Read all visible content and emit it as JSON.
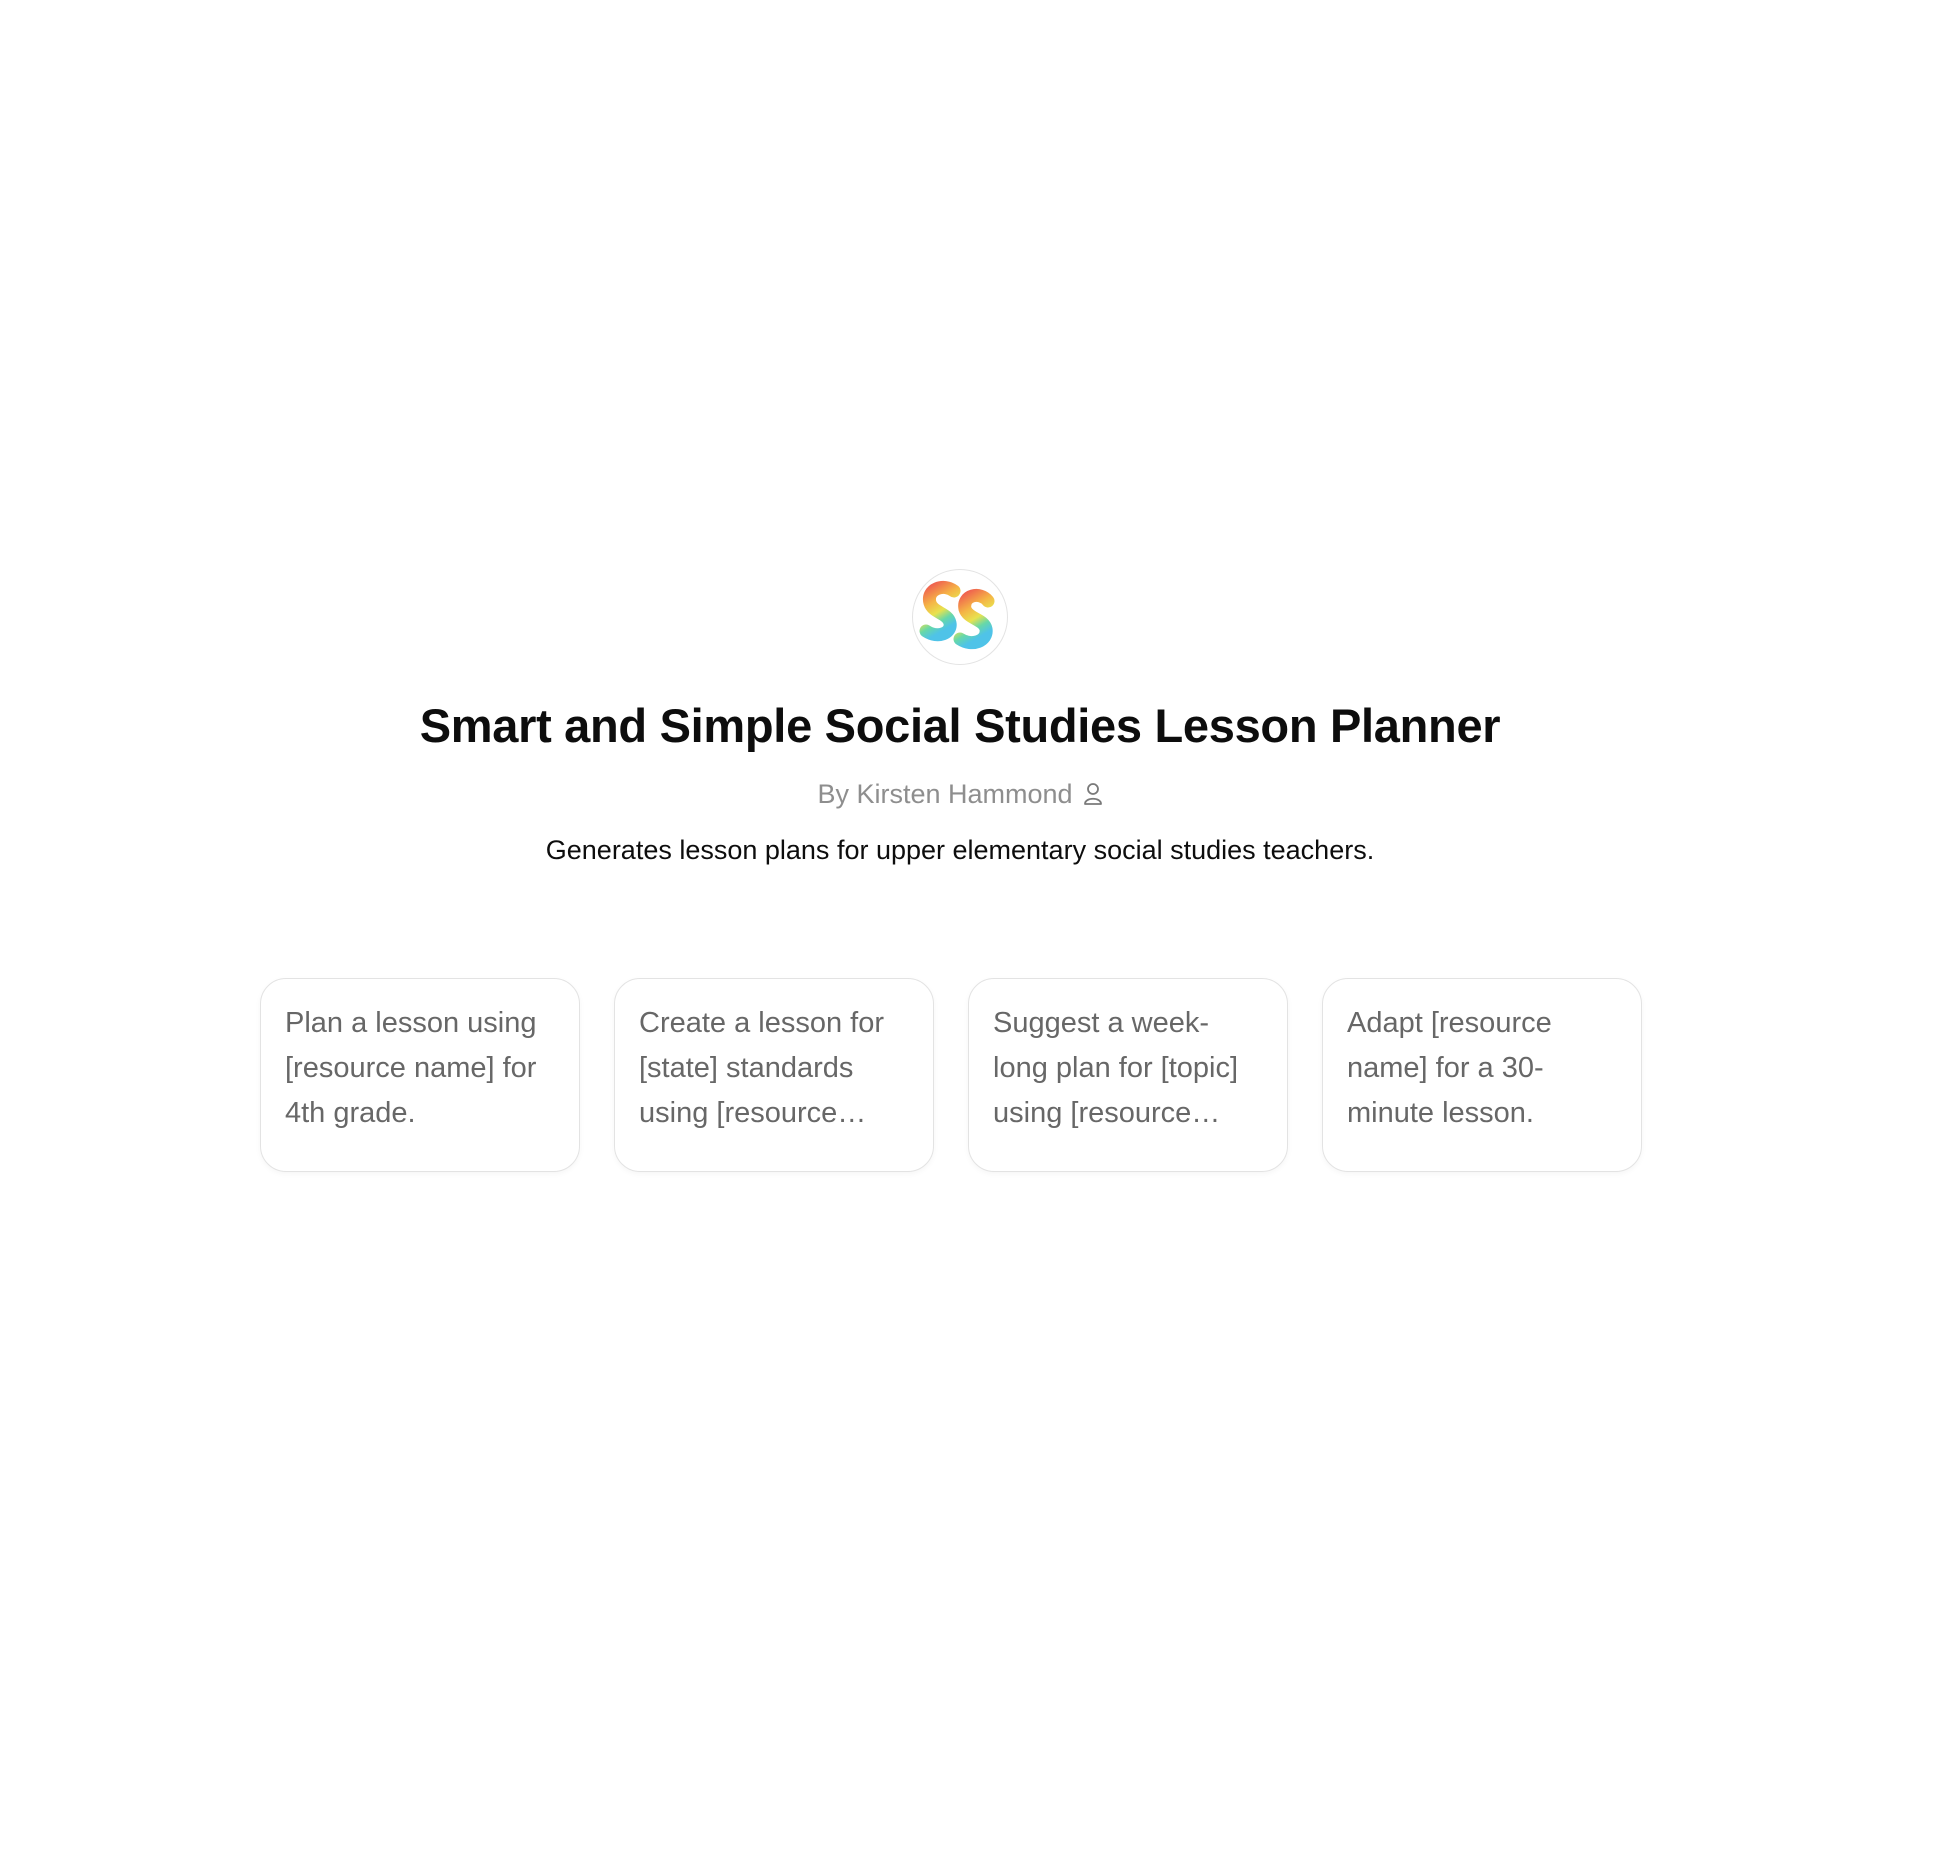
{
  "gpt": {
    "logo_icon": "ss-rainbow-logo-icon",
    "title": "Smart and Simple Social Studies Lesson Planner",
    "byline": "By Kirsten Hammond",
    "author_icon": "person-icon",
    "description": "Generates lesson plans for upper elementary social studies teachers."
  },
  "starters": [
    {
      "text": "Plan a lesson using [resource name] for 4th grade."
    },
    {
      "text": "Create a lesson for [state] standards using [resource name]."
    },
    {
      "text": "Suggest a week-long plan for [topic] using [resource name]."
    },
    {
      "text": "Adapt [resource name] for a 30-minute lesson."
    }
  ],
  "colors": {
    "title": "#0d0d0d",
    "byline": "#8e8e8e",
    "starter_text": "#676767",
    "border": "#e3e3e3",
    "logo_gradient": [
      "#ef6a4c",
      "#f6c243",
      "#5bd6c7",
      "#5ab5f0"
    ]
  }
}
